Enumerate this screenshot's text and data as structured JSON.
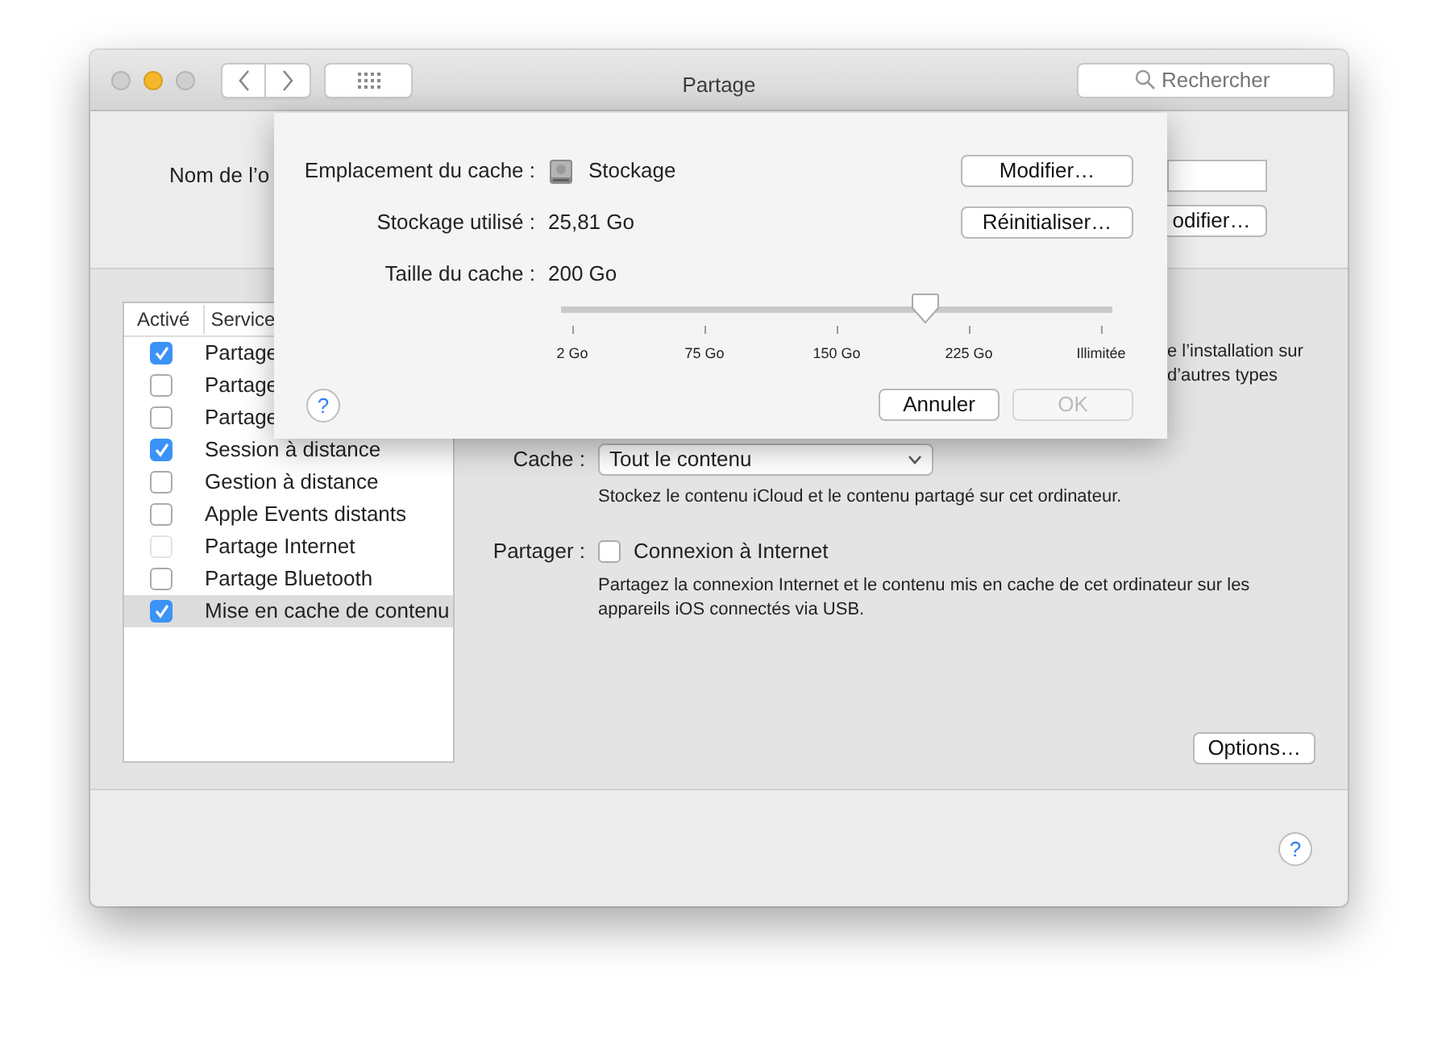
{
  "window": {
    "title": "Partage",
    "help": "?"
  },
  "toolbar": {
    "search": {
      "placeholder": "Rechercher"
    }
  },
  "computer_name": {
    "label": "Nom de l’o",
    "button": "odifier…"
  },
  "services": {
    "columns": [
      "Activé",
      "Service"
    ],
    "rows": [
      {
        "name": "Partage",
        "checked": true,
        "disabled": false,
        "selected": false
      },
      {
        "name": "Partage",
        "checked": false,
        "disabled": false,
        "selected": false
      },
      {
        "name": "Partage",
        "checked": false,
        "disabled": false,
        "selected": false
      },
      {
        "name": "Session à distance",
        "checked": true,
        "disabled": false,
        "selected": false
      },
      {
        "name": "Gestion à distance",
        "checked": false,
        "disabled": false,
        "selected": false
      },
      {
        "name": "Apple Events distants",
        "checked": false,
        "disabled": false,
        "selected": false
      },
      {
        "name": "Partage Internet",
        "checked": false,
        "disabled": true,
        "selected": false
      },
      {
        "name": "Partage Bluetooth",
        "checked": false,
        "disabled": false,
        "selected": false
      },
      {
        "name": "Mise en cache de contenu",
        "checked": true,
        "disabled": false,
        "selected": true
      }
    ]
  },
  "partial_description": [
    "e l’installation sur",
    "d’autres types"
  ],
  "cache": {
    "label": "Cache :",
    "value": "Tout le contenu",
    "description": "Stockez le contenu iCloud et le contenu partagé sur cet ordinateur."
  },
  "share": {
    "label": "Partager :",
    "option": "Connexion à Internet",
    "checked": false,
    "description": "Partagez la connexion Internet et le contenu mis en cache de cet ordinateur sur les appareils iOS connectés via USB."
  },
  "options_button": "Options…",
  "sheet": {
    "rows": [
      {
        "label": "Emplacement du cache :",
        "value": "Stockage",
        "kind": "disk",
        "button": "Modifier…"
      },
      {
        "label": "Stockage utilisé :",
        "value": "25,81 Go",
        "kind": "text",
        "button": "Réinitialiser…"
      },
      {
        "label": "Taille du cache :",
        "value": "200 Go",
        "kind": "text"
      }
    ],
    "slider": {
      "level": 0.66,
      "ticks": [
        "2 Go",
        "75 Go",
        "150 Go",
        "225 Go",
        "Illimitée"
      ]
    },
    "help": "?",
    "buttons": [
      {
        "label": "Annuler",
        "disabled": false
      },
      {
        "label": "OK",
        "disabled": true
      }
    ]
  }
}
